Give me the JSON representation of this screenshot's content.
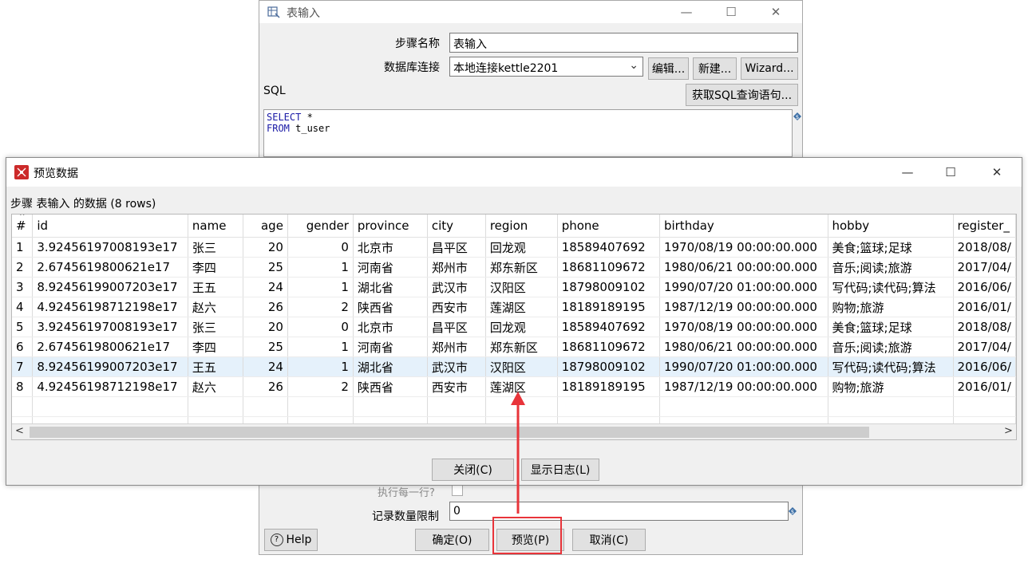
{
  "back_window": {
    "title": "表输入",
    "step_name_label": "步骤名称",
    "step_name_value": "表输入",
    "db_conn_label": "数据库连接",
    "db_conn_value": "本地连接kettle2201",
    "edit_btn": "编辑...",
    "new_btn": "新建...",
    "wizard_btn": "Wizard...",
    "sql_label": "SQL",
    "get_sql_btn": "获取SQL查询语句...",
    "sql_line1_kw": "SELECT",
    "sql_line1_rest": " *",
    "sql_line2_kw": "FROM",
    "sql_line2_rest": " t_user",
    "exec_each_row_label": "执行每一行?",
    "record_limit_label": "记录数量限制",
    "record_limit_value": "0",
    "help_btn": "Help",
    "ok_btn": "确定(O)",
    "preview_btn": "预览(P)",
    "cancel_btn": "取消(C)"
  },
  "preview_window": {
    "title": "预览数据",
    "subtitle": "步骤 表输入 的数据  (8 rows)",
    "close_btn": "关闭(C)",
    "show_log_btn": "显示日志(L)",
    "columns": [
      "#",
      "id",
      "name",
      "age",
      "gender",
      "province",
      "city",
      "region",
      "phone",
      "birthday",
      "hobby",
      "register_"
    ],
    "rows": [
      [
        "1",
        "3.92456197008193e17",
        "张三",
        "20",
        "0",
        "北京市",
        "昌平区",
        "回龙观",
        "18589407692",
        "1970/08/19 00:00:00.000",
        "美食;篮球;足球",
        "2018/08/"
      ],
      [
        "2",
        "2.6745619800621e17",
        "李四",
        "25",
        "1",
        "河南省",
        "郑州市",
        "郑东新区",
        "18681109672",
        "1980/06/21 00:00:00.000",
        "音乐;阅读;旅游",
        "2017/04/"
      ],
      [
        "3",
        "8.92456199007203e17",
        "王五",
        "24",
        "1",
        "湖北省",
        "武汉市",
        "汉阳区",
        "18798009102",
        "1990/07/20 01:00:00.000",
        "写代码;读代码;算法",
        "2016/06/"
      ],
      [
        "4",
        "4.92456198712198e17",
        "赵六",
        "26",
        "2",
        "陕西省",
        "西安市",
        "莲湖区",
        "18189189195",
        "1987/12/19 00:00:00.000",
        "购物;旅游",
        "2016/01/"
      ],
      [
        "5",
        "3.92456197008193e17",
        "张三",
        "20",
        "0",
        "北京市",
        "昌平区",
        "回龙观",
        "18589407692",
        "1970/08/19 00:00:00.000",
        "美食;篮球;足球",
        "2018/08/"
      ],
      [
        "6",
        "2.6745619800621e17",
        "李四",
        "25",
        "1",
        "河南省",
        "郑州市",
        "郑东新区",
        "18681109672",
        "1980/06/21 00:00:00.000",
        "音乐;阅读;旅游",
        "2017/04/"
      ],
      [
        "7",
        "8.92456199007203e17",
        "王五",
        "24",
        "1",
        "湖北省",
        "武汉市",
        "汉阳区",
        "18798009102",
        "1990/07/20 01:00:00.000",
        "写代码;读代码;算法",
        "2016/06/"
      ],
      [
        "8",
        "4.92456198712198e17",
        "赵六",
        "26",
        "2",
        "陕西省",
        "西安市",
        "莲湖区",
        "18189189195",
        "1987/12/19 00:00:00.000",
        "购物;旅游",
        "2016/01/"
      ]
    ],
    "selected_row": 7
  },
  "colors": {
    "annotation_red": "#e8343a",
    "selection": "#e5f1fb",
    "sql_keyword": "#1a1aa6",
    "app_icon_red": "#cc2a2a"
  }
}
